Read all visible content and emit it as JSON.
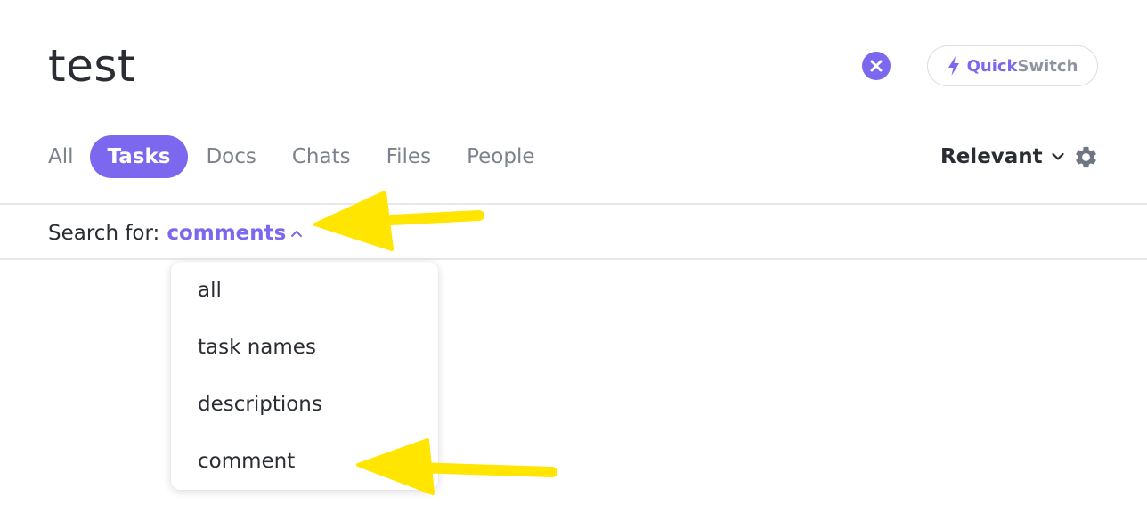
{
  "search": {
    "query": "test",
    "clear_icon": "close-icon"
  },
  "quickswitch": {
    "icon": "lightning-bolt-icon",
    "label_part1": "Quick",
    "label_part2": "Switch"
  },
  "tabs": [
    {
      "label": "All",
      "active": false
    },
    {
      "label": "Tasks",
      "active": true
    },
    {
      "label": "Docs",
      "active": false
    },
    {
      "label": "Chats",
      "active": false
    },
    {
      "label": "Files",
      "active": false
    },
    {
      "label": "People",
      "active": false
    }
  ],
  "sort": {
    "label": "Relevant",
    "icon": "chevron-down-icon",
    "settings_icon": "gear-icon"
  },
  "search_for": {
    "label": "Search for:",
    "value": "comments",
    "icon": "chevron-up-icon"
  },
  "dropdown": {
    "options": [
      "all",
      "task names",
      "descriptions",
      "comment"
    ]
  },
  "colors": {
    "accent": "#7b68ee",
    "annotation_arrow": "#ffe500",
    "text": "#2a2e34",
    "muted": "#7c828d"
  }
}
